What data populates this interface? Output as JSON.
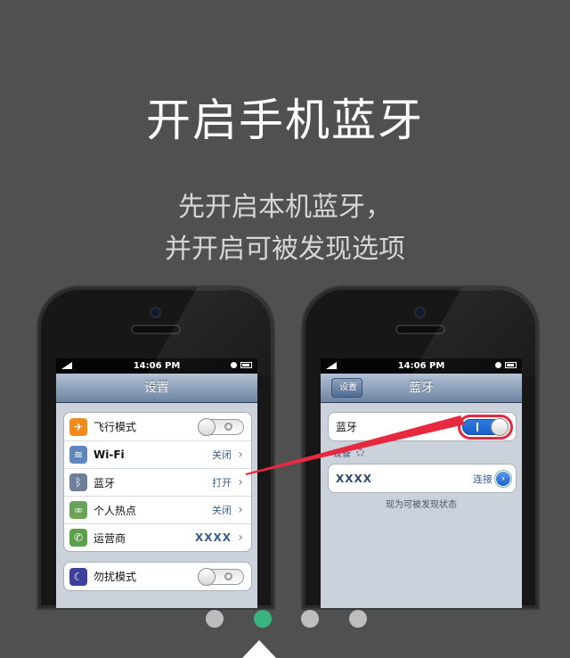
{
  "title": "开启手机蓝牙",
  "subtitle": [
    "先开启本机蓝牙，",
    "并开启可被发现选项"
  ],
  "colors": {
    "background": "#505050",
    "active_dot": "#3ab383",
    "inactive_dot": "#bdbdbd",
    "highlight": "#e8283f"
  },
  "left_phone": {
    "status_time": "14:06 PM",
    "nav_title": "设置",
    "group1": [
      {
        "icon": "airplane-icon",
        "label": "飞行模式",
        "value": "",
        "control": "toggle-off"
      },
      {
        "icon": "wifi-icon",
        "label": "Wi-Fi",
        "value": "关闭",
        "control": "chevron"
      },
      {
        "icon": "bluetooth-icon",
        "label": "蓝牙",
        "value": "打开",
        "control": "chevron"
      },
      {
        "icon": "hotspot-icon",
        "label": "个人热点",
        "value": "关闭",
        "control": "chevron"
      },
      {
        "icon": "phone-icon",
        "label": "运营商",
        "value": "XXXX",
        "control": "chevron"
      }
    ],
    "group2": [
      {
        "icon": "moon-icon",
        "label": "勿扰模式",
        "value": "",
        "control": "toggle-off"
      }
    ]
  },
  "right_phone": {
    "status_time": "14:06 PM",
    "back_label": "设置",
    "nav_title": "蓝牙",
    "bluetooth_label": "蓝牙",
    "toggle_state": "on",
    "section_header": "设备",
    "device_name": "XXXX",
    "device_action": "连接",
    "discoverable_note": "现为可被发现状态"
  },
  "pager": {
    "count": 4,
    "active_index": 1
  }
}
